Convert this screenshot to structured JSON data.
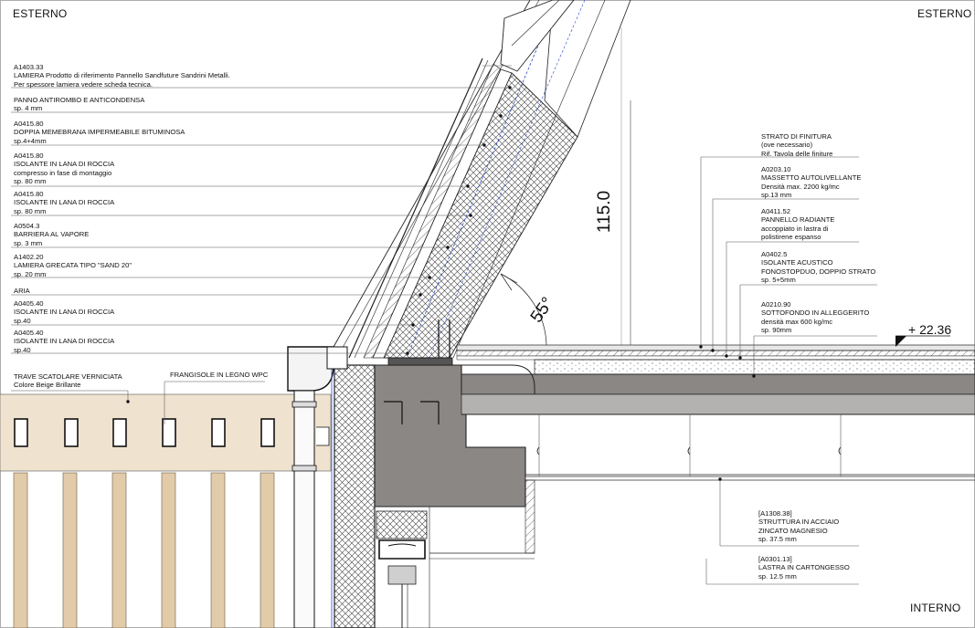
{
  "corners": {
    "top_left": "ESTERNO",
    "top_right": "ESTERNO",
    "bottom_right": "INTERNO"
  },
  "left_labels": [
    {
      "lines": [
        "A1403.33",
        "LAMIERA Prodotto di riferimento Pannello Sandfuture Sandrini Metalli.",
        "Per spessore lamiera vedere scheda tecnica."
      ]
    },
    {
      "lines": [
        "PANNO ANTIROMBO E ANTICONDENSA",
        "sp. 4 mm"
      ]
    },
    {
      "lines": [
        "A0415.80",
        "DOPPIA MEMEBRANA IMPERMEABILE BITUMINOSA",
        "sp.4+4mm"
      ]
    },
    {
      "lines": [
        "A0415.80",
        "ISOLANTE IN LANA DI ROCCIA",
        "compresso in fase di montaggio",
        "sp. 80 mm"
      ]
    },
    {
      "lines": [
        "A0415.80",
        "ISOLANTE IN LANA DI ROCCIA",
        "sp. 80 mm"
      ]
    },
    {
      "lines": [
        "A0504.3",
        "BARRIERA AL VAPORE",
        "sp. 3 mm"
      ]
    },
    {
      "lines": [
        "A1402.20",
        "LAMIERA GRECATA TIPO \"SAND 20\"",
        "sp. 20 mm"
      ]
    },
    {
      "lines": [
        "ARIA"
      ]
    },
    {
      "lines": [
        "A0405.40",
        "ISOLANTE IN LANA DI ROCCIA",
        "sp.40"
      ]
    },
    {
      "lines": [
        "A0405.40",
        "ISOLANTE IN LANA DI ROCCIA",
        "sp.40"
      ]
    },
    {
      "lines": [
        "TRAVE SCATOLARE VERNICIATA",
        "Colore Beige Brillante"
      ]
    },
    {
      "lines": [
        "FRANGISOLE IN LEGNO WPC"
      ]
    }
  ],
  "right_labels": [
    {
      "lines": [
        "STRATO DI FINITURA",
        "(ove necessario)",
        "Rif. Tavola delle finiture"
      ]
    },
    {
      "lines": [
        "A0203.10",
        "MASSETTO AUTOLIVELLANTE",
        "Densità max. 2200 kg/mc",
        "sp.13 mm"
      ]
    },
    {
      "lines": [
        "A0411.52",
        "PANNELLO RADIANTE",
        "accoppiato in lastra di",
        "polistirene espanso"
      ]
    },
    {
      "lines": [
        "A0402.5",
        "ISOLANTE ACUSTICO",
        "FONOSTOPDUO, DOPPIO STRATO",
        "sp. 5+5mm"
      ]
    },
    {
      "lines": [
        "A0210.90",
        "SOTTOFONDO IN ALLEGGERITO",
        "densità max 600 kg/mc",
        "sp. 90mm"
      ]
    },
    {
      "lines": [
        "[A1308.38]",
        "STRUTTURA IN ACCIAIO",
        "ZINCATO MAGNESIO",
        "sp.      37.5 mm"
      ]
    },
    {
      "lines": [
        "[A0301.13]",
        "LASTRA IN CARTONGESSO",
        "sp. 12.5 mm"
      ]
    }
  ],
  "dimension": "115.0",
  "angle": "55°",
  "elevation": "+ 22.36",
  "colors": {
    "line": "#222222",
    "leader": "#555555",
    "beige": "#efe2cf",
    "wood": "#e2cba9",
    "concrete": "#8a8785",
    "concrete_light": "#b4b2b0",
    "screed": "#d9d9d9",
    "insulation": "#f2f2f2",
    "blue": "#2a4cc8"
  }
}
